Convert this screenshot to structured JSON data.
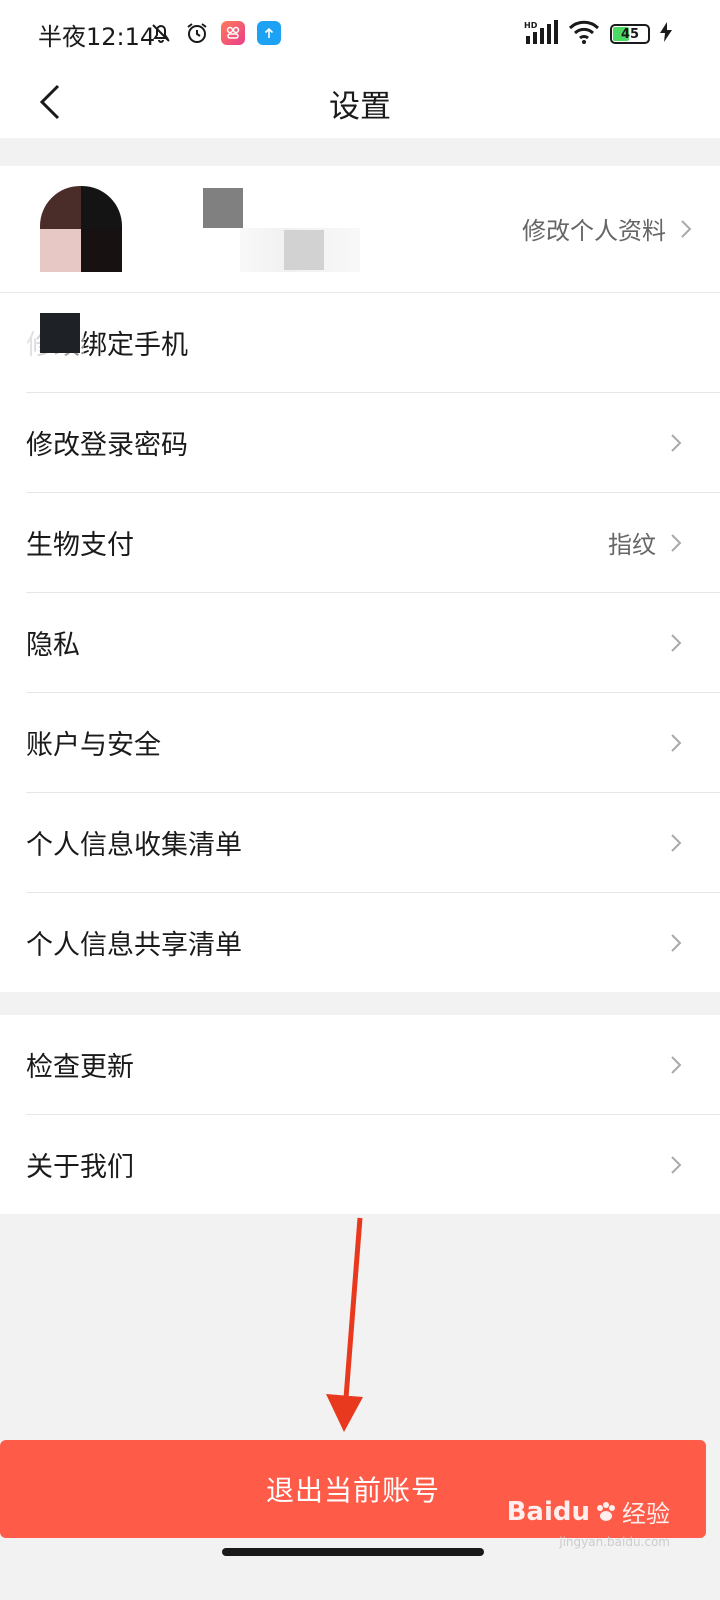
{
  "status_bar": {
    "time": "半夜12:14",
    "battery_level": "45",
    "battery_fraction": 0.45,
    "icons": [
      "bell-off-icon",
      "alarm-icon",
      "app-icon-pink",
      "app-icon-blue",
      "hd-signal-icon",
      "wifi-icon",
      "battery-icon",
      "charging-icon"
    ]
  },
  "nav": {
    "title": "设置"
  },
  "profile": {
    "edit_label": "修改个人资料"
  },
  "group1": [
    {
      "label": "修改绑定手机",
      "value": ""
    },
    {
      "label": "修改登录密码",
      "value": ""
    },
    {
      "label": "生物支付",
      "value": "指纹"
    },
    {
      "label": "隐私",
      "value": ""
    },
    {
      "label": "账户与安全",
      "value": ""
    },
    {
      "label": "个人信息收集清单",
      "value": ""
    },
    {
      "label": "个人信息共享清单",
      "value": ""
    }
  ],
  "group2": [
    {
      "label": "检查更新",
      "value": ""
    },
    {
      "label": "关于我们",
      "value": ""
    }
  ],
  "logout": {
    "label": "退出当前账号"
  },
  "watermark": {
    "text": "Baidu",
    "sub": "经验",
    "url": "jingyan.baidu.com"
  },
  "colors": {
    "accent": "#fe5b48",
    "annotation_arrow": "#e8391f",
    "background": "#f2f2f2"
  }
}
